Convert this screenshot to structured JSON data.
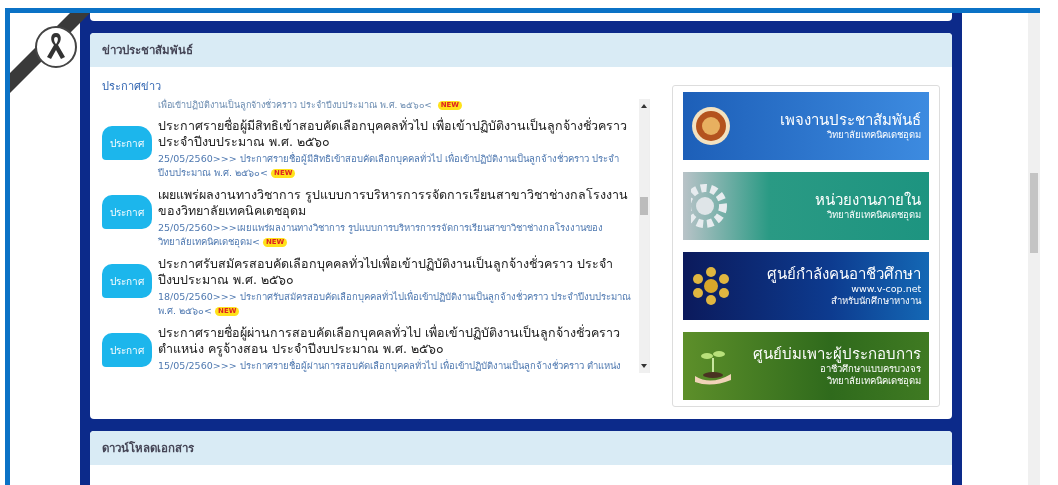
{
  "news_panel": {
    "title": "ข่าวประชาสัมพันธ์",
    "section_label": "ประกาศข่าว",
    "clipped_line": {
      "text": "เพื่อเข้าปฏิบัติงานเป็นลูกจ้างชั่วคราว ประจำปีงบประมาณ พ.ศ. ๒๕๖๐<",
      "badge": "NEW"
    },
    "items": [
      {
        "icon_label": "ประกาศ",
        "title": "ประกาศรายชื่อผู้มีสิทธิเข้าสอบคัดเลือกบุคคลทั่วไป เพื่อเข้าปฏิบัติงานเป็นลูกจ้างชั่วคราว ประจำปีงบประมาณ พ.ศ. ๒๕๖๐",
        "summary": "25/05/2560>>> ประกาศรายชื่อผู้มีสิทธิเข้าสอบคัดเลือกบุคคลทั่วไป เพื่อเข้าปฏิบัติงานเป็นลูกจ้างชั่วคราว ประจำปีงบประมาณ พ.ศ. ๒๕๖๐<",
        "badge": "NEW"
      },
      {
        "icon_label": "ประกาศ",
        "title": "เผยแพร่ผลงานทางวิชาการ รูปแบบการบริหารการรจัดการเรียนสาขาวิชาช่างกลโรงงานของวิทยาลัยเทคนิคเดชอุดม",
        "summary": "25/05/2560>>>เผยแพร่ผลงานทางวิชาการ รูปแบบการบริหารการรจัดการเรียนสาขาวิชาช่างกลโรงงานของวิทยาลัยเทคนิคเดชอุดม<",
        "badge": "NEW"
      },
      {
        "icon_label": "ประกาศ",
        "title": "ประกาศรับสมัครสอบคัดเลือกบุคคลทั่วไปเพื่อเข้าปฏิบัติงานเป็นลูกจ้างชั่วคราว ประจำปีงบประมาณ พ.ศ. ๒๕๖๐",
        "summary": "18/05/2560>>> ประกาศรับสมัครสอบคัดเลือกบุคคลทั่วไปเพื่อเข้าปฏิบัติงานเป็นลูกจ้างชั่วคราว ประจำปีงบประมาณ พ.ศ. ๒๕๖๐<",
        "badge": "NEW"
      },
      {
        "icon_label": "ประกาศ",
        "title": "ประกาศรายชื่อผู้ผ่านการสอบคัดเลือกบุคคลทั่วไป เพื่อเข้าปฏิบัติงานเป็นลูกจ้างชั่วคราว ตำแหน่ง ครูจ้างสอน ประจำปีงบประมาณ พ.ศ. ๒๕๖๐",
        "summary": "15/05/2560>>> ประกาศรายชื่อผู้ผ่านการสอบคัดเลือกบุคคลทั่วไป เพื่อเข้าปฏิบัติงานเป็นลูกจ้างชั่วคราว ตำแหน่ง"
      }
    ],
    "banners": [
      {
        "kind": "seal",
        "title": "เพจงานประชาสัมพันธ์",
        "lines": [
          "วิทยาลัยเทคนิคเดชอุดม"
        ]
      },
      {
        "kind": "gears",
        "title": "หน่วยงานภายใน",
        "lines": [
          "วิทยาลัยเทคนิคเดชอุดม"
        ]
      },
      {
        "kind": "network",
        "title": "ศูนย์กำลังคนอาชีวศึกษา",
        "lines": [
          "www.v-cop.net",
          "สำหรับนักศึกษาหางาน"
        ]
      },
      {
        "kind": "plant",
        "title": "ศูนย์บ่มเพาะผู้ประกอบการ",
        "lines": [
          "อาชีวศึกษาแบบครบวงจร",
          "วิทยาลัยเทคนิคเดชอุดม"
        ]
      }
    ]
  },
  "download_panel": {
    "title": "ดาวน์โหลดเอกสาร"
  }
}
